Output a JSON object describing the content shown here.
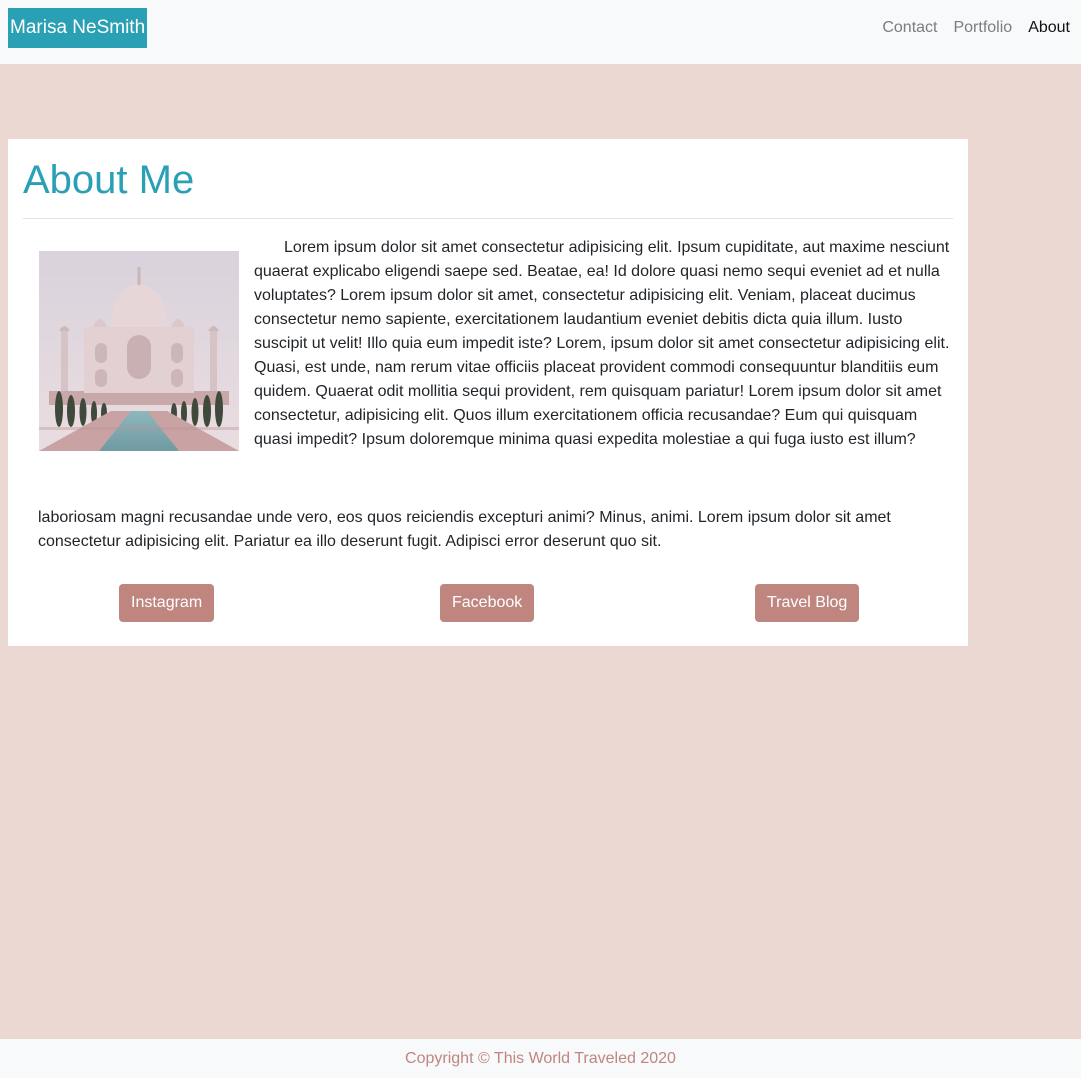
{
  "navbar": {
    "brand": "Marisa NeSmith",
    "links": [
      "Contact",
      "Portfolio",
      "About"
    ],
    "active_link": "About"
  },
  "about": {
    "title": "About Me",
    "paragraph_main": "Lorem ipsum dolor sit amet consectetur adipisicing elit. Ipsum cupiditate, aut maxime nesciunt quaerat explicabo eligendi saepe sed. Beatae, ea! Id dolore quasi nemo sequi eveniet ad et nulla voluptates? Lorem ipsum dolor sit amet, consectetur adipisicing elit. Veniam, placeat ducimus consectetur nemo sapiente, exercitationem laudantium eveniet debitis dicta quia illum. Iusto suscipit ut velit! Illo quia eum impedit iste? Lorem, ipsum dolor sit amet consectetur adipisicing elit. Quasi, est unde, nam rerum vitae officiis placeat provident commodi consequuntur blanditiis eum quidem. Quaerat odit mollitia sequi provident, rem quisquam pariatur! Lorem ipsum dolor sit amet consectetur, adipisicing elit. Quos illum exercitationem officia recusandae? Eum qui quisquam quasi impedit? Ipsum doloremque minima quasi expedita molestiae a qui fuga iusto est illum?",
    "paragraph_continued": "laboriosam magni recusandae unde vero, eos quos reiciendis excepturi animi? Minus, animi. Lorem ipsum dolor sit amet consectetur adipisicing elit. Pariatur ea illo deserunt fugit. Adipisci error deserunt quo sit.",
    "buttons": {
      "instagram": "Instagram",
      "facebook": "Facebook",
      "travel_blog": "Travel Blog"
    }
  },
  "footer": {
    "text": "Copyright © This World Traveled 2020"
  },
  "colors": {
    "page_background": "#ecd8d3",
    "accent": "#2aa0b4",
    "button": "#bf8680",
    "navbar_background": "#f8f9fa"
  }
}
